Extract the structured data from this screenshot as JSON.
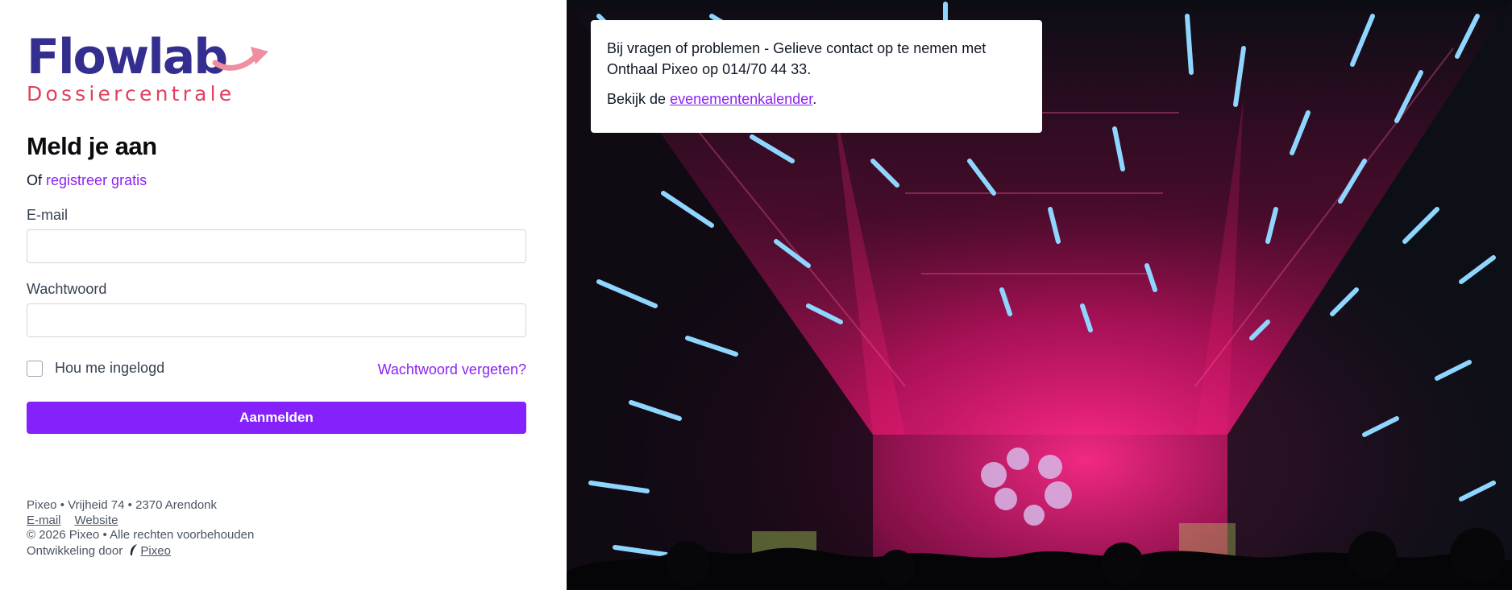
{
  "brand": {
    "name": "Flowlab",
    "subtitle": "Dossiercentrale",
    "primary_color": "#342f8f",
    "accent_color": "#e0405d",
    "arrow_color": "#f08da0"
  },
  "login": {
    "title": "Meld je aan",
    "or_text": "Of",
    "register_link": "registreer gratis",
    "email_label": "E-mail",
    "email_value": "",
    "password_label": "Wachtwoord",
    "password_value": "",
    "remember_label": "Hou me ingelogd",
    "remember_checked": false,
    "forgot_link": "Wachtwoord vergeten?",
    "submit_label": "Aanmelden",
    "button_color": "#8522fb"
  },
  "footer": {
    "company": "Pixeo",
    "address": "Vrijheid 74",
    "postal": "2370 Arendonk",
    "separator": "•",
    "email_link": "E-mail",
    "website_link": "Website",
    "copyright": "© 2026 Pixeo",
    "rights": "Alle rechten voorbehouden",
    "developed_by": "Ontwikkeling door",
    "developer_link": "Pixeo"
  },
  "notice": {
    "line1": "Bij vragen of problemen - Gelieve contact op te nemen met Onthaal Pixeo op 014/70 44 33.",
    "line2_prefix": "Bekijk de",
    "line2_link": "evenementenkalender",
    "line2_suffix": "."
  }
}
